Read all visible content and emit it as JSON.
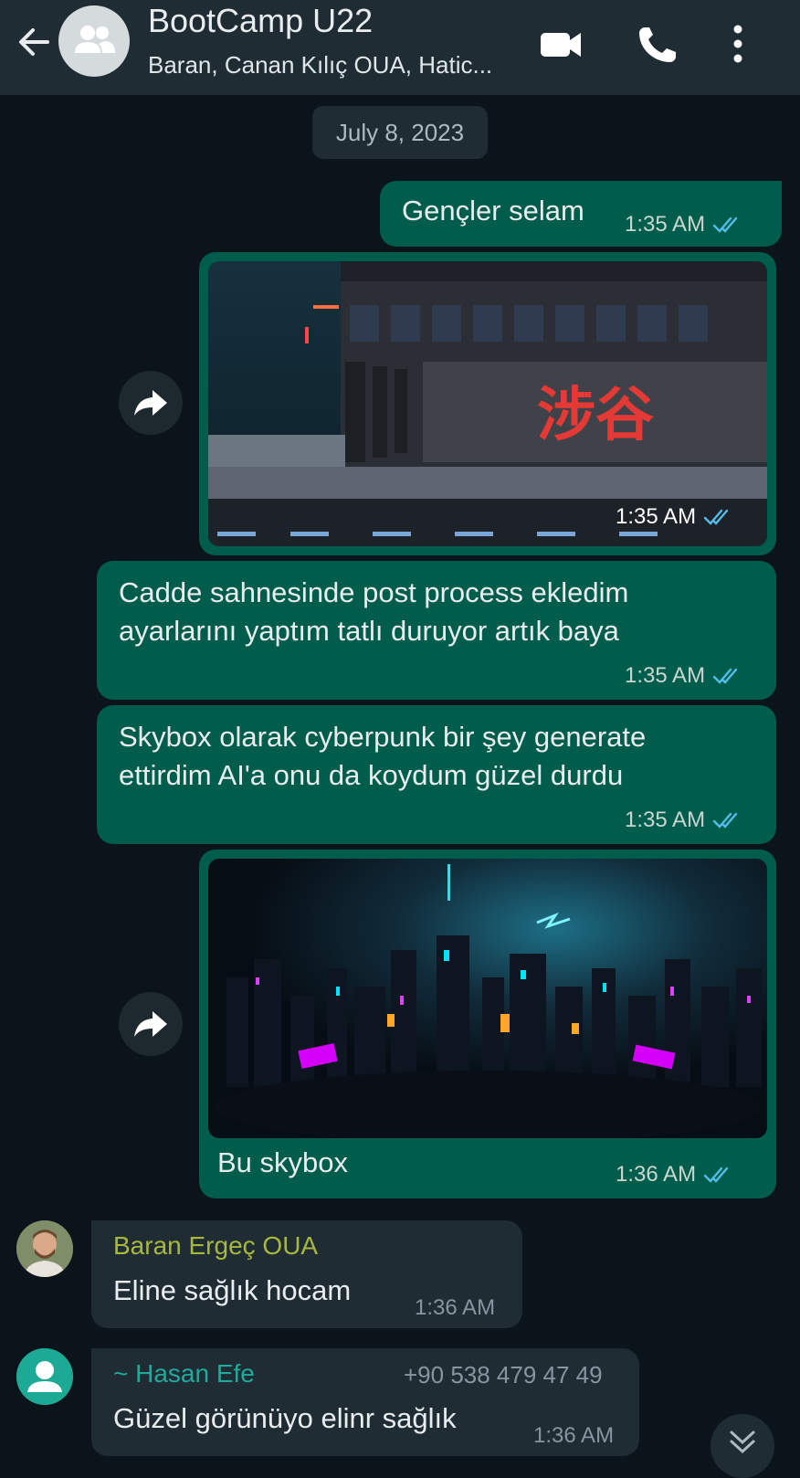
{
  "header": {
    "title": "BootCamp U22",
    "subtitle": "Baran, Canan Kılıç OUA, Hatic..."
  },
  "date_chip": "July 8, 2023",
  "messages": [
    {
      "text": "Gençler selam",
      "time": "1:35 AM"
    },
    {
      "time": "1:35 AM",
      "image_text": "涉谷"
    },
    {
      "text_line1": "Cadde sahnesinde post process ekledim",
      "text_line2": "ayarlarını yaptım tatlı duruyor artık baya",
      "time": "1:35 AM"
    },
    {
      "text_line1": "Skybox olarak cyberpunk bir şey generate",
      "text_line2": "ettirdim AI'a onu da koydum güzel durdu",
      "time": "1:35 AM"
    },
    {
      "caption": "Bu skybox",
      "time": "1:36 AM"
    },
    {
      "sender": "Baran Ergeç OUA",
      "text": "Eline sağlık hocam",
      "time": "1:36 AM"
    },
    {
      "sender": "~ Hasan Efe",
      "phone": "+90 538 479 47 49",
      "text": "Güzel görünüyo elinr sağlık",
      "time": "1:36 AM"
    }
  ],
  "colors": {
    "background": "#0b141a",
    "header": "#1f2c34",
    "outgoing_bubble": "#005c4b",
    "incoming_bubble": "#1f2c34",
    "read_ticks": "#53bdeb",
    "sender_baran": "#a8b83c",
    "sender_hasan": "#1faa9c"
  },
  "icons": [
    "back-arrow-icon",
    "group-avatar-icon",
    "video-call-icon",
    "voice-call-icon",
    "more-options-icon",
    "forward-icon",
    "read-ticks-icon",
    "person-avatar-icon",
    "scroll-down-icon"
  ]
}
